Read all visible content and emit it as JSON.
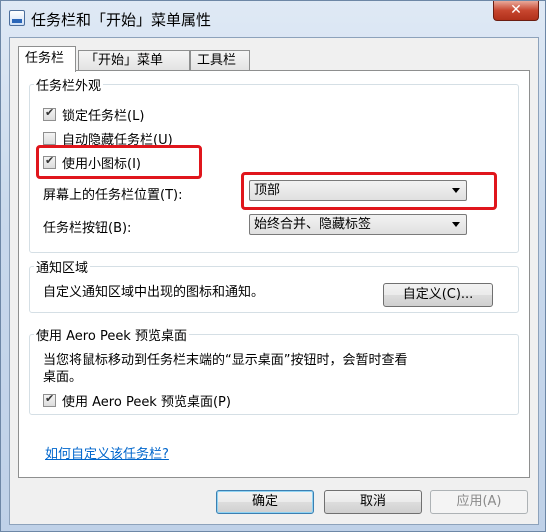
{
  "window": {
    "title": "任务栏和「开始」菜单属性",
    "close_glyph": "✕"
  },
  "tabs": [
    {
      "label": "任务栏",
      "active": true
    },
    {
      "label": "「开始」菜单",
      "active": false
    },
    {
      "label": "工具栏",
      "active": false
    }
  ],
  "appearance": {
    "legend": "任务栏外观",
    "lock_label": "锁定任务栏(L)",
    "lock_checked": true,
    "autohide_label": "自动隐藏任务栏(U)",
    "autohide_checked": false,
    "small_icons_label": "使用小图标(I)",
    "small_icons_checked": true,
    "position_label": "屏幕上的任务栏位置(T):",
    "position_value": "顶部",
    "buttons_label": "任务栏按钮(B):",
    "buttons_value": "始终合并、隐藏标签"
  },
  "notification": {
    "legend": "通知区域",
    "description": "自定义通知区域中出现的图标和通知。",
    "customize_button": "自定义(C)..."
  },
  "aero_peek": {
    "legend": "使用 Aero Peek 预览桌面",
    "description_line1": "当您将鼠标移动到任务栏末端的“显示桌面”按钮时，会暂时查看",
    "description_line2": "桌面。",
    "checkbox_label": "使用 Aero Peek 预览桌面(P)",
    "checked": true
  },
  "help_link": "如何自定义该任务栏?",
  "footer": {
    "ok": "确定",
    "cancel": "取消",
    "apply": "应用(A)"
  },
  "colors": {
    "highlight": "#e0161c",
    "link": "#0066cc"
  }
}
